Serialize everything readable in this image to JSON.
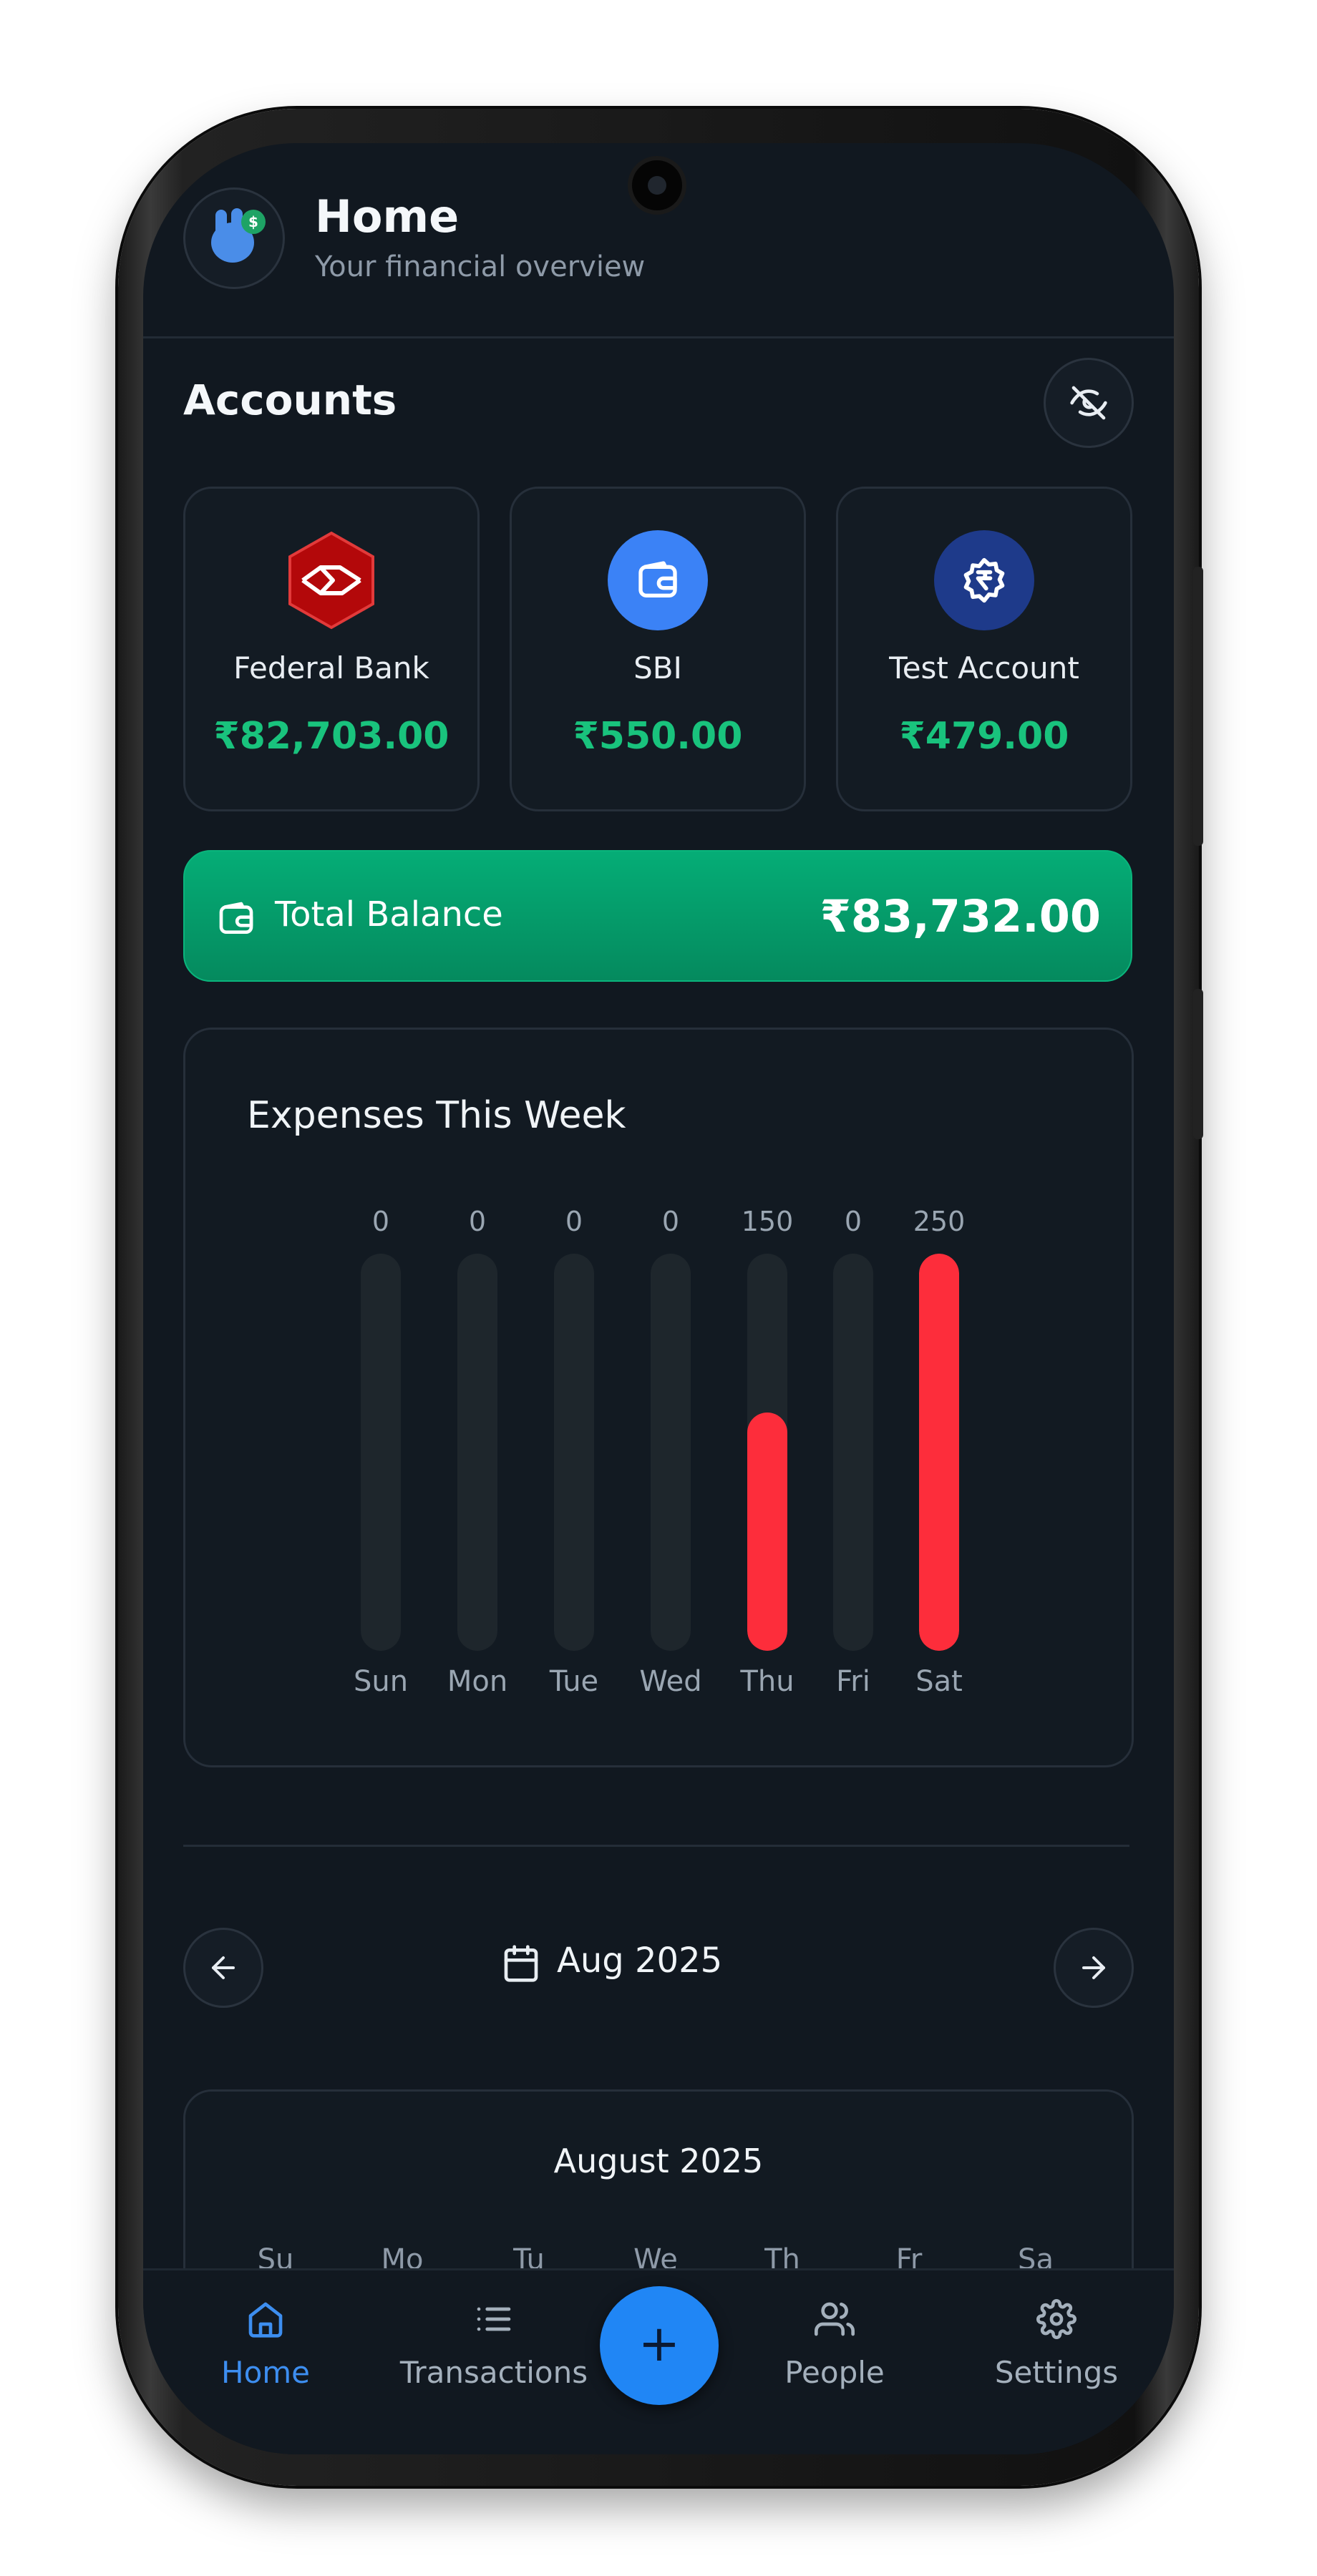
{
  "header": {
    "title": "Home",
    "subtitle": "Your financial overview"
  },
  "accounts": {
    "title": "Accounts",
    "toggle_icon": "eye-off-icon",
    "items": [
      {
        "name": "Federal Bank",
        "balance": "₹82,703.00",
        "icon": "federal-bank-logo",
        "color": "#b3080a"
      },
      {
        "name": "SBI",
        "balance": "₹550.00",
        "icon": "wallet-icon",
        "color": "#3b82f6"
      },
      {
        "name": "Test Account",
        "balance": "₹479.00",
        "icon": "rupee-icon",
        "color": "#1e3a8a"
      }
    ]
  },
  "total": {
    "label": "Total Balance",
    "value": "₹83,732.00",
    "icon": "wallet-icon",
    "color": "#05a06e"
  },
  "chart": {
    "title": "Expenses This Week"
  },
  "chart_data": {
    "type": "bar",
    "title": "Expenses This Week",
    "categories": [
      "Sun",
      "Mon",
      "Tue",
      "Wed",
      "Thu",
      "Fri",
      "Sat"
    ],
    "values": [
      0,
      0,
      0,
      0,
      150,
      0,
      250
    ],
    "value_labels": [
      "0",
      "0",
      "0",
      "0",
      "150",
      "0",
      "250"
    ],
    "ylim": [
      0,
      250
    ],
    "bar_color": "#fd2d3b",
    "track_color": "#1e262c"
  },
  "month_nav": {
    "label": "Aug 2025",
    "prev_icon": "arrow-left-icon",
    "next_icon": "arrow-right-icon"
  },
  "calendar": {
    "title": "August 2025",
    "weekdays": [
      "Su",
      "Mo",
      "Tu",
      "We",
      "Th",
      "Fr",
      "Sa"
    ]
  },
  "bottom_nav": {
    "tabs": [
      {
        "label": "Home",
        "icon": "home-icon",
        "active": true
      },
      {
        "label": "Transactions",
        "icon": "list-icon",
        "active": false
      },
      {
        "label": "People",
        "icon": "people-icon",
        "active": false
      },
      {
        "label": "Settings",
        "icon": "gear-icon",
        "active": false
      }
    ],
    "fab_label": "+"
  },
  "colors": {
    "background": "#111820",
    "positive": "#19c37d",
    "expense": "#fd2d3b",
    "accent": "#2086f5"
  }
}
